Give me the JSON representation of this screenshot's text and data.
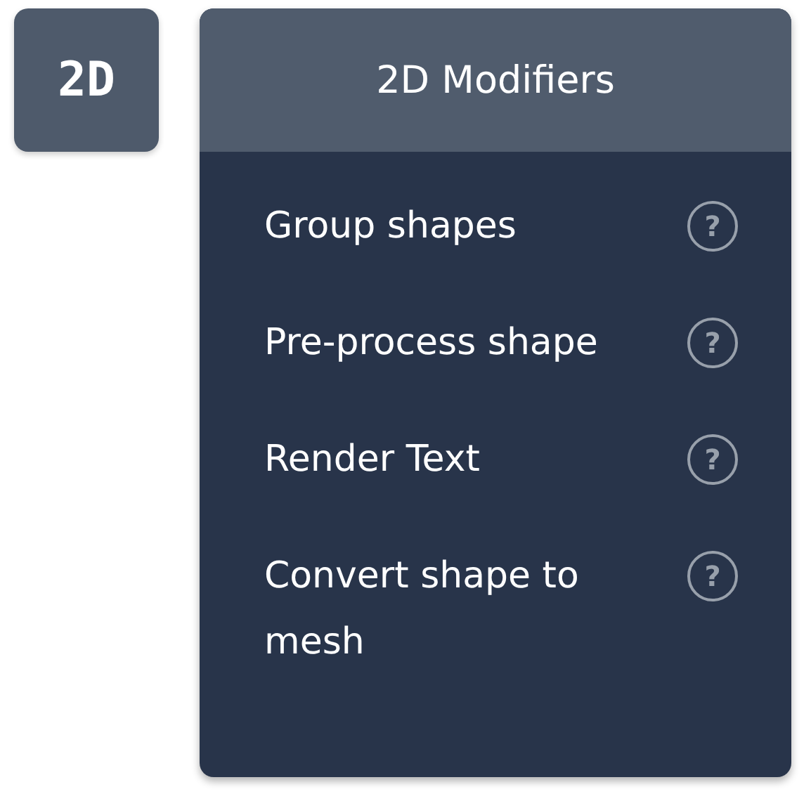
{
  "mode_button": {
    "label": "2D"
  },
  "panel": {
    "title": "2D Modifiers",
    "items": [
      {
        "label": "Group shapes",
        "help": "?"
      },
      {
        "label": "Pre-process shape",
        "help": "?"
      },
      {
        "label": "Render Text",
        "help": "?"
      },
      {
        "label": "Convert shape to mesh",
        "help": "?"
      }
    ]
  }
}
